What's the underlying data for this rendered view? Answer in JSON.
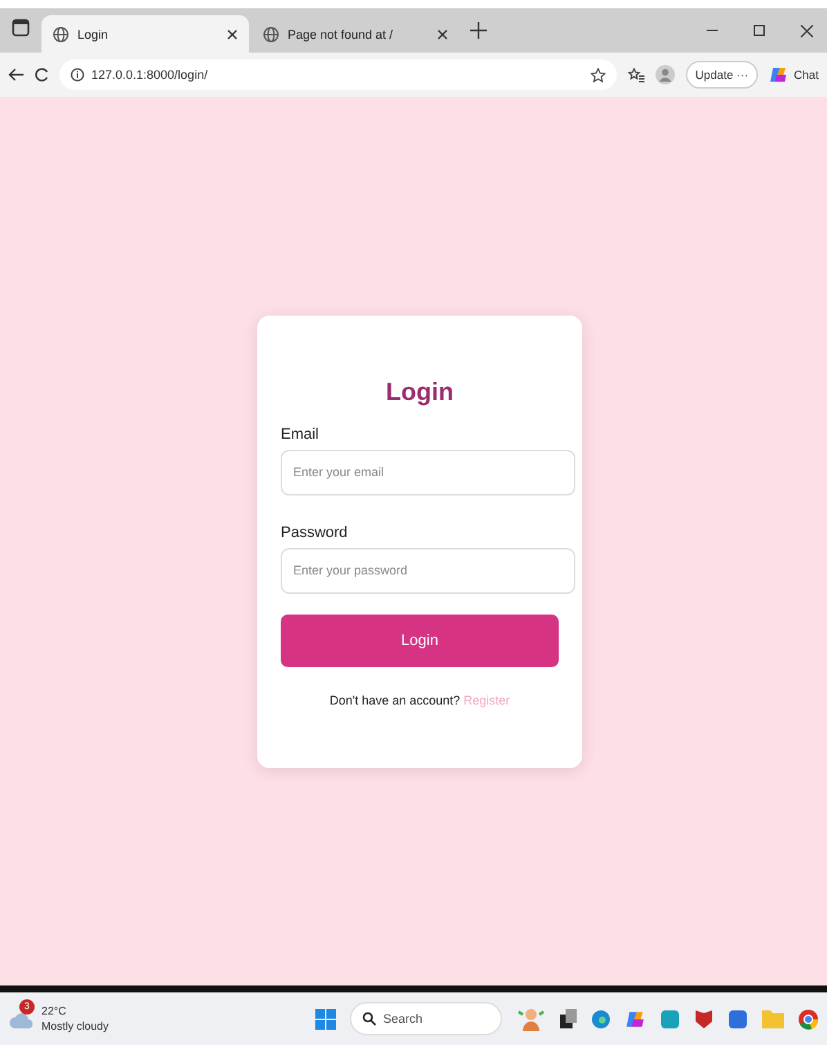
{
  "tabs": [
    {
      "title": "Login",
      "selected": true
    },
    {
      "title": "Page not found at /",
      "selected": false
    }
  ],
  "address": "127.0.0.1:8000/login/",
  "toolbar": {
    "update_button": "Update ···",
    "chat_button": "Chat"
  },
  "login_form": {
    "title": "Login",
    "fields": [
      {
        "label": "Email",
        "placeholder": "Enter your email"
      },
      {
        "label": "Password",
        "placeholder": "Enter your password"
      }
    ],
    "submit": "Login",
    "prompt": "Don't have an account?",
    "link": "Register"
  },
  "taskbar": {
    "weather": {
      "badge": "3",
      "temperature": "22°C",
      "condition": "Mostly cloudy"
    },
    "search": {
      "placeholder": "Search"
    }
  }
}
